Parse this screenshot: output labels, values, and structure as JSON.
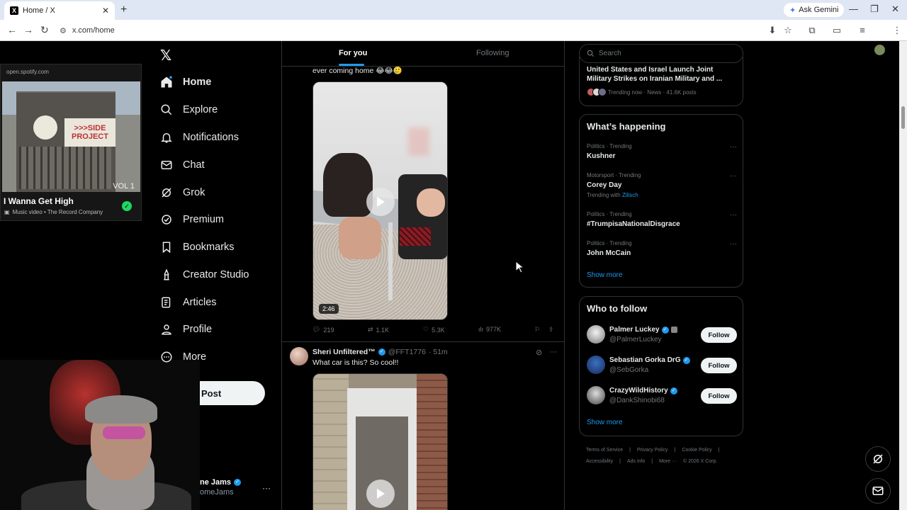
{
  "browser": {
    "tab_title": "Home / X",
    "tab_favicon": "X",
    "new_tab": "+",
    "gemini_label": "Ask Gemini",
    "url": "x.com/home"
  },
  "spotify": {
    "source": "open.spotify.com",
    "album_sign": ">>>SIDE PROJECT",
    "album_vol": "VOL 1",
    "song_title": "I Wanna Get High",
    "song_sub": "Music video • The Record Company"
  },
  "nav": {
    "items": [
      {
        "label": "Home",
        "icon": "home-icon"
      },
      {
        "label": "Explore",
        "icon": "search-icon"
      },
      {
        "label": "Notifications",
        "icon": "bell-icon"
      },
      {
        "label": "Chat",
        "icon": "mail-icon"
      },
      {
        "label": "Grok",
        "icon": "grok-icon"
      },
      {
        "label": "Premium",
        "icon": "premium-icon"
      },
      {
        "label": "Bookmarks",
        "icon": "bookmark-icon"
      },
      {
        "label": "Creator Studio",
        "icon": "creator-icon"
      },
      {
        "label": "Articles",
        "icon": "articles-icon"
      },
      {
        "label": "Profile",
        "icon": "person-icon"
      },
      {
        "label": "More",
        "icon": "more-icon"
      }
    ],
    "post_label": "Post",
    "account_name": "ne Jams",
    "account_handle": "omeJams"
  },
  "feed": {
    "tabs": [
      "For you",
      "Following"
    ],
    "tweet1": {
      "caption": "ever coming home 😂😂🥲",
      "duration": "2:46",
      "replies": "219",
      "reposts": "1.1K",
      "likes": "5.3K",
      "views": "977K"
    },
    "tweet2": {
      "name": "Sheri Unfiltered™",
      "handle": "@FFT1776",
      "time": "· 51m",
      "text": "What car is this?  So cool!!"
    }
  },
  "right": {
    "search_placeholder": "Search",
    "news": {
      "headline": "United States and Israel Launch Joint Military Strikes on Iranian Military and ...",
      "meta": "Trending now · News · 41.6K posts"
    },
    "happening": {
      "title": "What’s happening",
      "trends": [
        {
          "category": "Politics · Trending",
          "title": "Kushner",
          "with": ""
        },
        {
          "category": "Motorsport · Trending",
          "title": "Corey Day",
          "with_prefix": "Trending with",
          "with": "Zilisch"
        },
        {
          "category": "Politics · Trending",
          "title": "#TrumpisaNationalDisgrace",
          "with": ""
        },
        {
          "category": "Politics · Trending",
          "title": "John McCain",
          "with": ""
        }
      ],
      "show_more": "Show more"
    },
    "who_to_follow": {
      "title": "Who to follow",
      "accounts": [
        {
          "name": "Palmer Luckey",
          "handle": "@PalmerLuckey",
          "button": "Follow"
        },
        {
          "name": "Sebastian Gorka DrG",
          "handle": "@SebGorka",
          "button": "Follow"
        },
        {
          "name": "CrazyWildHistory",
          "handle": "@DankShinobi68",
          "button": "Follow"
        }
      ],
      "show_more": "Show more"
    },
    "footer": [
      "Terms of Service",
      "|",
      "Privacy Policy",
      "|",
      "Cookie Policy",
      "|",
      "Accessibility",
      "|",
      "Ads info",
      "|",
      "More ···",
      "© 2026 X Corp."
    ]
  },
  "colors": {
    "accent": "#1d9bf0",
    "background": "#000000",
    "text": "#e7e9ea",
    "muted": "#71767b"
  }
}
